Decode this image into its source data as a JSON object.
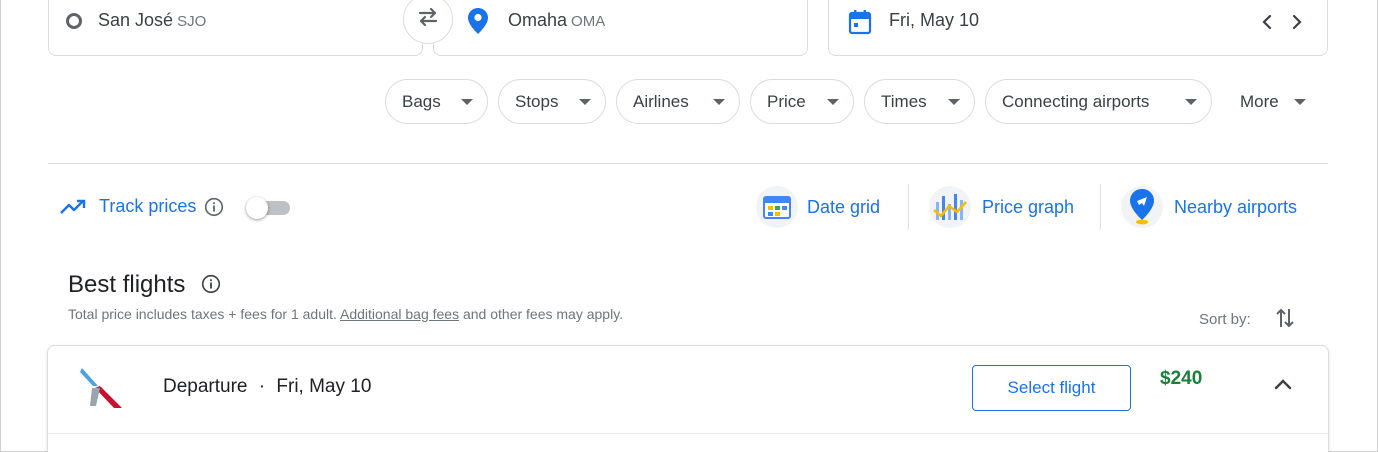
{
  "search": {
    "origin_city": "San José",
    "origin_code": "SJO",
    "destination_city": "Omaha",
    "destination_code": "OMA",
    "date": "Fri, May 10"
  },
  "filters": [
    "Bags",
    "Stops",
    "Airlines",
    "Price",
    "Times",
    "Connecting airports",
    "More"
  ],
  "tools": {
    "track_prices": "Track prices",
    "date_grid": "Date grid",
    "price_graph": "Price graph",
    "nearby_airports": "Nearby airports"
  },
  "results": {
    "heading": "Best flights",
    "note_prefix": "Total price includes taxes + fees for 1 adult. ",
    "note_link": "Additional bag fees",
    "note_suffix": " and other fees may apply.",
    "sort_by": "Sort by:"
  },
  "flight": {
    "direction": "Departure",
    "separator": "·",
    "date": "Fri, May 10",
    "select_label": "Select flight",
    "price": "$240"
  },
  "colors": {
    "accent": "#1a73e8",
    "price_green": "#188038"
  }
}
